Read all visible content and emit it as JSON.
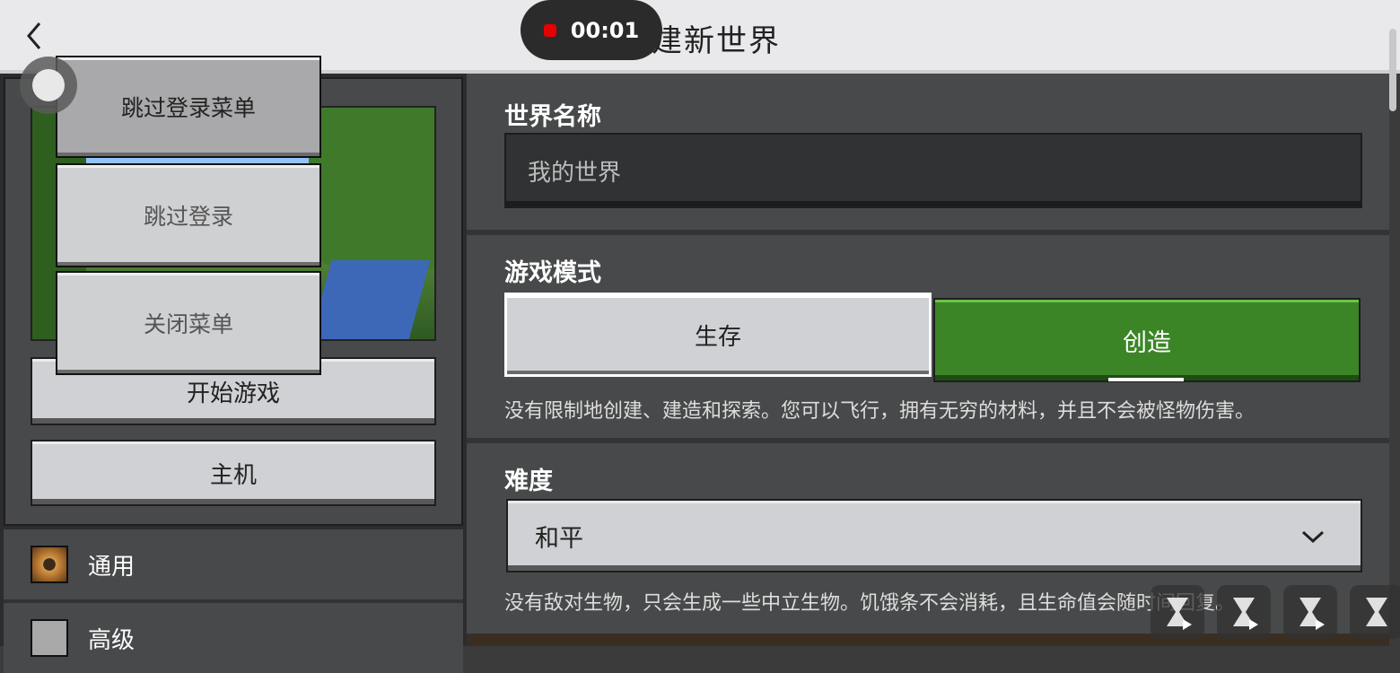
{
  "header": {
    "title": "创建新世界",
    "back_icon": "chevron-left-icon"
  },
  "recording": {
    "time": "00:01",
    "color": "#e60000"
  },
  "left": {
    "start_button": "开始游戏",
    "host_button": "主机",
    "general": "通用",
    "advanced": "高级"
  },
  "overlay_menu": {
    "skip_login_menu": "跳过登录菜单",
    "skip_login": "跳过登录",
    "close_menu": "关闭菜单"
  },
  "form": {
    "world_name_label": "世界名称",
    "world_name_placeholder": "我的世界",
    "game_mode_label": "游戏模式",
    "mode_survival": "生存",
    "mode_creative": "创造",
    "mode_description": "没有限制地创建、建造和探索。您可以飞行，拥有无穷的材料，并且不会被怪物伤害。",
    "difficulty_label": "难度",
    "difficulty_value": "和平",
    "difficulty_description": "没有敌对生物，只会生成一些中立生物。饥饿条不会消耗，且生命值会随时间回复。"
  },
  "colors": {
    "creative_green": "#3c8527",
    "panel": "#48494a",
    "topbar": "#e9e9ec"
  }
}
